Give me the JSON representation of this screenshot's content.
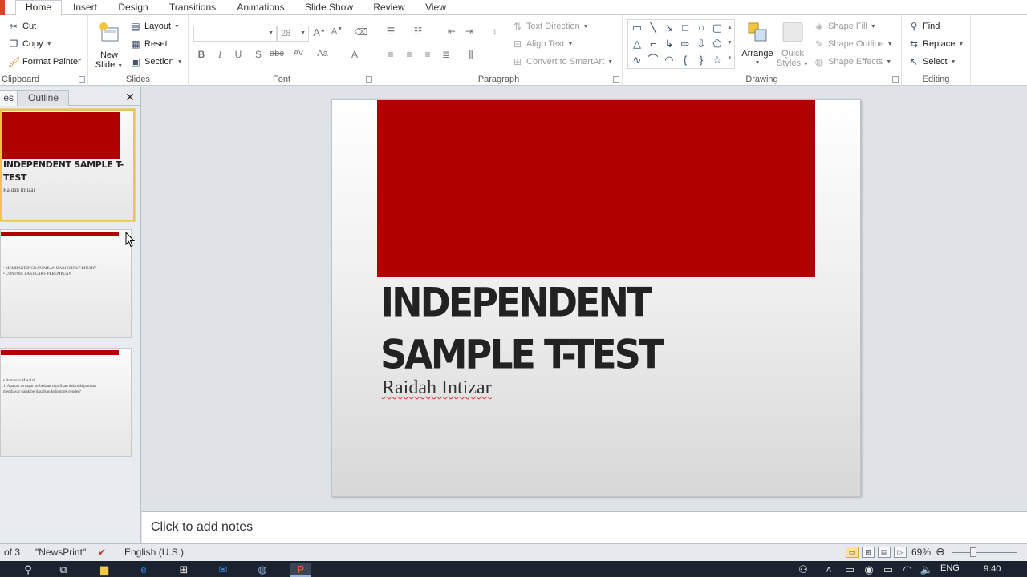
{
  "ribbon_tabs": [
    {
      "label": "Home",
      "active": true
    },
    {
      "label": "Insert"
    },
    {
      "label": "Design"
    },
    {
      "label": "Transitions"
    },
    {
      "label": "Animations"
    },
    {
      "label": "Slide Show"
    },
    {
      "label": "Review"
    },
    {
      "label": "View"
    }
  ],
  "clipboard": {
    "cut": "Cut",
    "copy": "Copy",
    "format_painter": "Format Painter",
    "label": "Clipboard"
  },
  "slides_group": {
    "new_slide_line1": "New",
    "new_slide_line2": "Slide",
    "layout": "Layout",
    "reset": "Reset",
    "section": "Section",
    "label": "Slides"
  },
  "font_group": {
    "font_name": "",
    "font_size": "28",
    "label": "Font"
  },
  "paragraph_group": {
    "text_direction": "Text Direction",
    "align_text": "Align Text",
    "convert_smartart": "Convert to SmartArt",
    "label": "Paragraph"
  },
  "drawing_group": {
    "arrange": "Arrange",
    "quick_styles_line1": "Quick",
    "quick_styles_line2": "Styles",
    "shape_fill": "Shape Fill",
    "shape_outline": "Shape Outline",
    "shape_effects": "Shape Effects",
    "label": "Drawing"
  },
  "editing_group": {
    "find": "Find",
    "replace": "Replace",
    "select": "Select",
    "label": "Editing"
  },
  "panel": {
    "tab_slides_fragment": "es",
    "tab_outline": "Outline"
  },
  "thumbnails": [
    {
      "title": "INDEPENDENT  SAMPLE T-TEST",
      "subtitle": "Raidah Intizar"
    },
    {
      "lines": [
        "• MEMBANDINGKAN   MEAN DARI GROUP  BINARY",
        "• CONTOH: LAKI-LAKI- PEREMPUAN"
      ]
    },
    {
      "lines": [
        "• Rumusan Masalah",
        "1.  Apakah terdapat perbedaan signifikan dalam kepatuhan",
        "membayar pajak berdasarkan kelompok gender?"
      ]
    }
  ],
  "slide": {
    "title": "INDEPENDENT SAMPLE T-TEST",
    "subtitle": "Raidah Intizar",
    "accent_color": "#b00000"
  },
  "notes": {
    "placeholder": "Click to add notes"
  },
  "status": {
    "slide_counter": "of 3",
    "theme": "\"NewsPrint\"",
    "language": "English (U.S.)",
    "zoom": "69%",
    "zoom_fraction": 0.69
  },
  "taskbar": {
    "lang": "ENG",
    "time": "9:40"
  }
}
